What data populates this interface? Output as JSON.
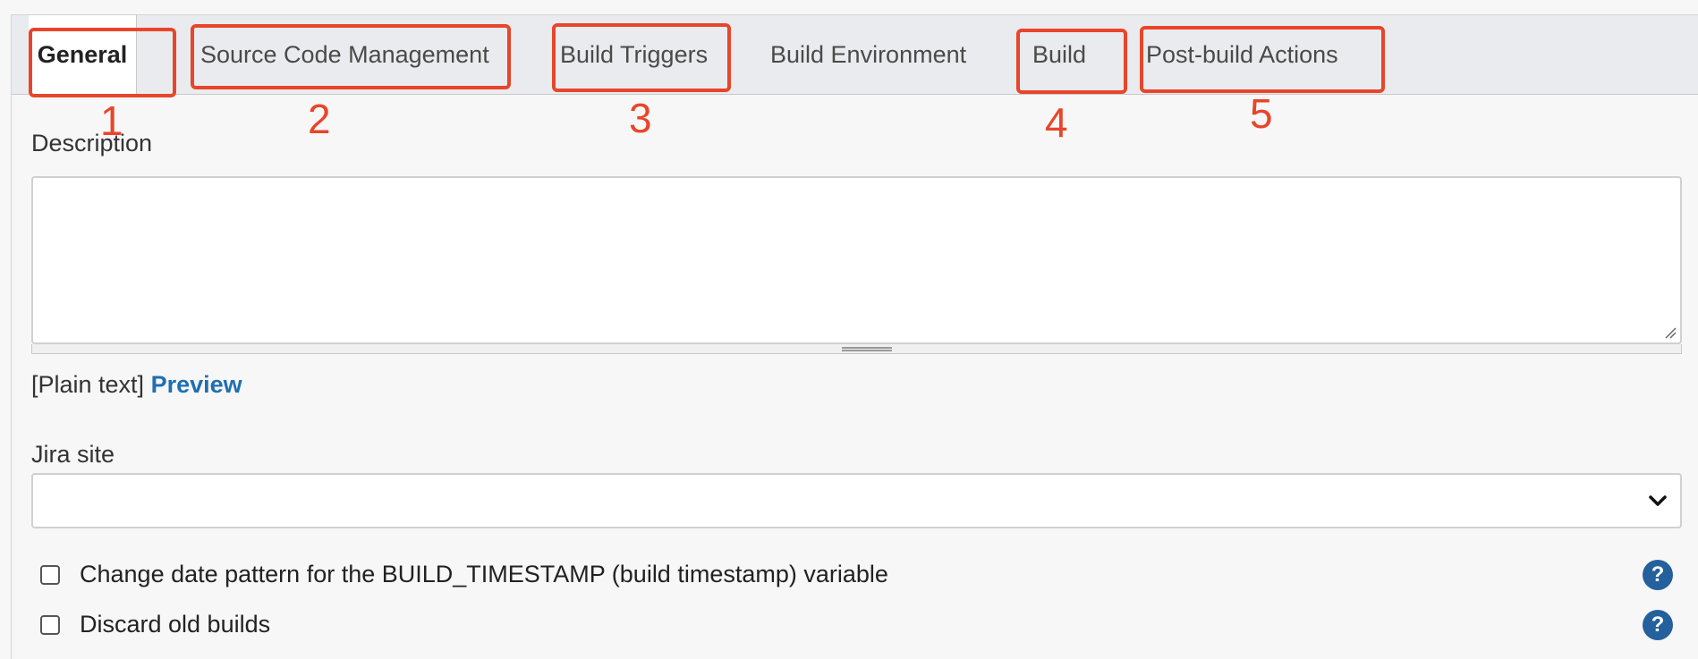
{
  "tabs": [
    {
      "label": "General",
      "active": true
    },
    {
      "label": "Source Code Management"
    },
    {
      "label": "Build Triggers"
    },
    {
      "label": "Build Environment"
    },
    {
      "label": "Build"
    },
    {
      "label": "Post-build Actions"
    }
  ],
  "annotations": [
    "1",
    "2",
    "3",
    "4",
    "5"
  ],
  "colors": {
    "annotation": "#e8452a",
    "link": "#1f6fb2",
    "help": "#24609c"
  },
  "description": {
    "label": "Description",
    "value": "",
    "format_text": "[Plain text]",
    "preview_label": "Preview"
  },
  "jira": {
    "label": "Jira site",
    "selected": ""
  },
  "options": [
    {
      "label": "Change date pattern for the BUILD_TIMESTAMP (build timestamp) variable",
      "checked": false,
      "help": "?"
    },
    {
      "label": "Discard old builds",
      "checked": false,
      "help": "?"
    }
  ],
  "icons": {
    "dropdown": "chevron-down-icon",
    "help": "question-mark-icon"
  }
}
